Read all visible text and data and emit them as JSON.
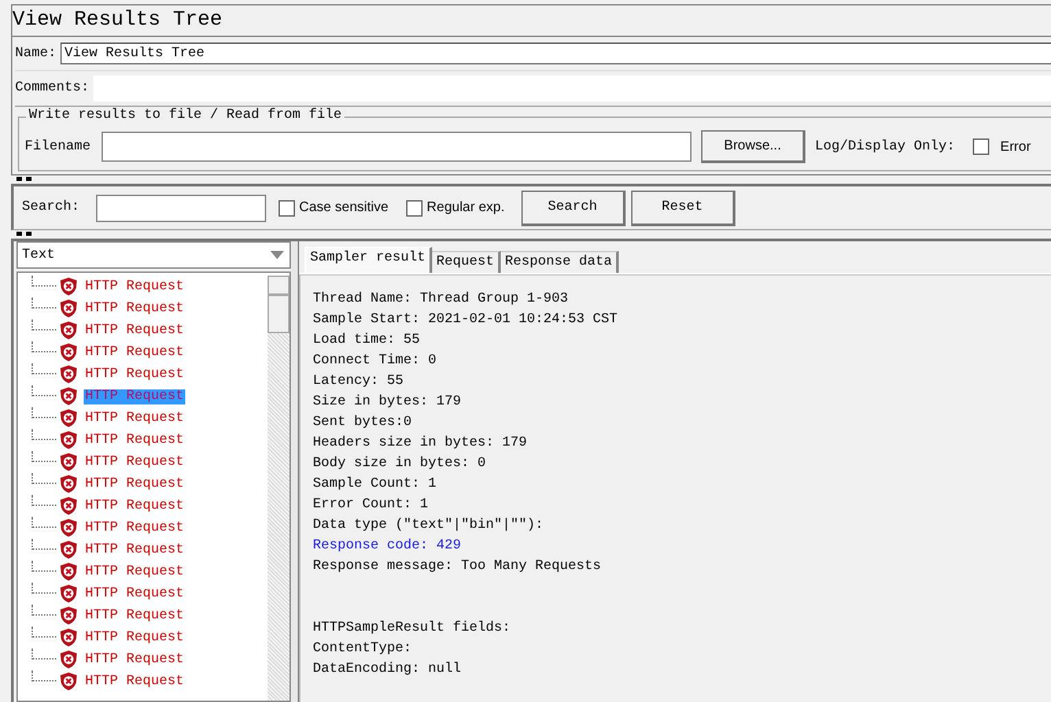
{
  "window": {
    "title": "View Results Tree"
  },
  "name_field": {
    "label": "Name:",
    "value": "View Results Tree"
  },
  "comments_field": {
    "label": "Comments:"
  },
  "file_group": {
    "title": "Write results to file / Read from file",
    "filename_label": "Filename",
    "browse_button": "Browse...",
    "log_display_label": "Log/Display Only:",
    "errors_checkbox": {
      "label": "Error",
      "checked": false
    }
  },
  "search": {
    "label": "Search:",
    "options": [
      {
        "label": "Case sensitive",
        "checked": false
      },
      {
        "label": "Regular exp.",
        "checked": false
      }
    ],
    "buttons": [
      "Search",
      "Reset"
    ]
  },
  "renderer": {
    "value": "Text"
  },
  "tree": {
    "items": [
      {
        "label": "HTTP Request",
        "selected": false
      },
      {
        "label": "HTTP Request",
        "selected": false
      },
      {
        "label": "HTTP Request",
        "selected": false
      },
      {
        "label": "HTTP Request",
        "selected": false
      },
      {
        "label": "HTTP Request",
        "selected": false
      },
      {
        "label": "HTTP Request",
        "selected": true
      },
      {
        "label": "HTTP Request",
        "selected": false
      },
      {
        "label": "HTTP Request",
        "selected": false
      },
      {
        "label": "HTTP Request",
        "selected": false
      },
      {
        "label": "HTTP Request",
        "selected": false
      },
      {
        "label": "HTTP Request",
        "selected": false
      },
      {
        "label": "HTTP Request",
        "selected": false
      },
      {
        "label": "HTTP Request",
        "selected": false
      },
      {
        "label": "HTTP Request",
        "selected": false
      },
      {
        "label": "HTTP Request",
        "selected": false
      },
      {
        "label": "HTTP Request",
        "selected": false
      },
      {
        "label": "HTTP Request",
        "selected": false
      },
      {
        "label": "HTTP Request",
        "selected": false
      },
      {
        "label": "HTTP Request",
        "selected": false
      }
    ]
  },
  "tabs": [
    {
      "label": "Sampler result",
      "selected": true
    },
    {
      "label": "Request",
      "selected": false
    },
    {
      "label": "Response data",
      "selected": false
    }
  ],
  "result_lines": [
    {
      "text": "Thread Name: Thread Group 1-903",
      "kind": "plain"
    },
    {
      "text": "Sample Start: 2021-02-01 10:24:53 CST",
      "kind": "plain"
    },
    {
      "text": "Load time: 55",
      "kind": "plain"
    },
    {
      "text": "Connect Time: 0",
      "kind": "plain"
    },
    {
      "text": "Latency: 55",
      "kind": "plain"
    },
    {
      "text": "Size in bytes: 179",
      "kind": "plain"
    },
    {
      "text": "Sent bytes:0",
      "kind": "plain"
    },
    {
      "text": "Headers size in bytes: 179",
      "kind": "plain"
    },
    {
      "text": "Body size in bytes: 0",
      "kind": "plain"
    },
    {
      "text": "Sample Count: 1",
      "kind": "plain"
    },
    {
      "text": "Error Count: 1",
      "kind": "plain"
    },
    {
      "text": "Data type (\"text\"|\"bin\"|\"\"):",
      "kind": "plain"
    },
    {
      "text": "Response code: 429",
      "kind": "code"
    },
    {
      "text": "Response message: Too Many Requests",
      "kind": "plain"
    },
    {
      "text": "HTTPSampleResult fields:",
      "kind": "section"
    },
    {
      "text": "ContentType:",
      "kind": "plain"
    },
    {
      "text": "DataEncoding: null",
      "kind": "plain"
    }
  ]
}
